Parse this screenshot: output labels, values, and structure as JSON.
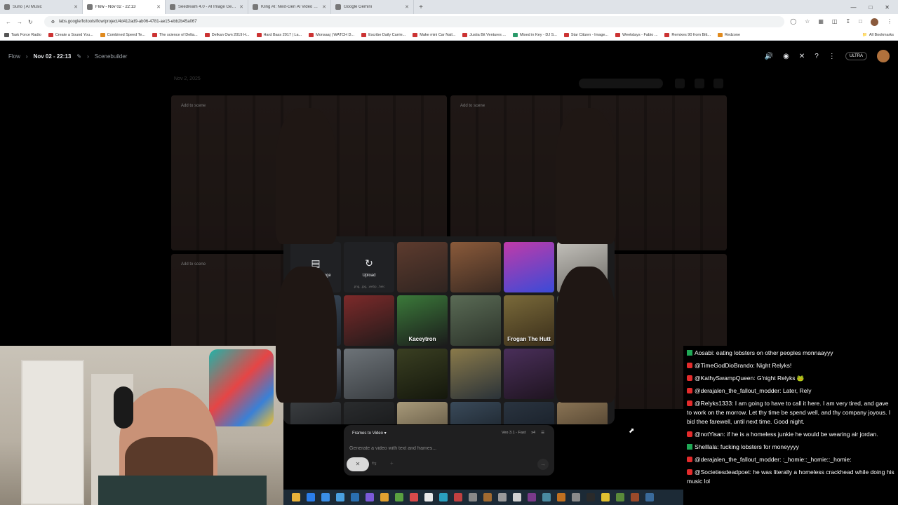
{
  "browser": {
    "tabs": [
      {
        "label": "Suno | AI Music",
        "active": false
      },
      {
        "label": "Flow - Nov 02 - 22:13",
        "active": true
      },
      {
        "label": "Seedream 4.0 - AI Image Gene...",
        "active": false
      },
      {
        "label": "Kling AI: Next-Gen AI Video &...",
        "active": false
      },
      {
        "label": "Google Gemini",
        "active": false
      }
    ],
    "url": "labs.google/fx/tools/flow/project/4d412ad9-ab06-4781-ae15-ebb2b45a067",
    "bookmarks": [
      "Task Force Radio",
      "Create a Sound You...",
      "Combined Speed Te...",
      "The science of Delta...",
      "Delkan Own 2019 H...",
      "Hard Bass 2017 | La...",
      "Monsaaj | WATCH D...",
      "Escribe Daily Carrie...",
      "Make mini Car Nail...",
      "Justia Bit Ventures ...",
      "Mixed in Key - DJ S...",
      "Star Citizen - Image...",
      "Weekdays - Fabio ...",
      "Remixes 90 from Bitt...",
      "Redzone"
    ],
    "bookmarks_right": "All Bookmarks"
  },
  "app": {
    "brand": "Flow",
    "project": "Nov 02 - 22:13",
    "view": "Scenebuilder",
    "badge": "ULTRA",
    "date_label": "Nov 2, 2025"
  },
  "scenes": [
    {
      "tag": "Add to scene"
    },
    {
      "tag": "Add to scene"
    },
    {
      "tag": "Add to scene"
    }
  ],
  "picker": {
    "generate_label": "Generate Image",
    "upload_label": "Upload",
    "upload_sub": ".png, .jpg, .webp, .heic",
    "tiles": [
      {
        "caption": "",
        "colors": [
          "#5d3b2e",
          "#2f2420"
        ]
      },
      {
        "caption": "",
        "colors": [
          "#8a5a3a",
          "#3a2a22"
        ]
      },
      {
        "caption": "",
        "colors": [
          "#c13aa8",
          "#3a4bd8"
        ]
      },
      {
        "caption": "",
        "colors": [
          "#c2c0ba",
          "#6e6b66"
        ]
      },
      {
        "caption": "",
        "colors": [
          "#3c4a5a",
          "#1d242c"
        ]
      },
      {
        "caption": "",
        "colors": [
          "#7d2a2a",
          "#211a1a"
        ]
      },
      {
        "caption": "Kaceytron",
        "colors": [
          "#3b7a3a",
          "#1b1b1b"
        ]
      },
      {
        "caption": "",
        "colors": [
          "#5a6b55",
          "#2c332a"
        ]
      },
      {
        "caption": "Frogan The Hutt",
        "colors": [
          "#7a6a3a",
          "#3a2e1a"
        ]
      },
      {
        "caption": "",
        "colors": [
          "#4a5a4a",
          "#1c2420"
        ]
      },
      {
        "caption": "",
        "colors": [
          "#6a7482",
          "#1c2026"
        ]
      },
      {
        "caption": "",
        "colors": [
          "#6d7378",
          "#3a3e42"
        ]
      },
      {
        "caption": "",
        "colors": [
          "#3a3f22",
          "#14170c"
        ]
      },
      {
        "caption": "",
        "colors": [
          "#8a7a4a",
          "#2a3238"
        ]
      },
      {
        "caption": "",
        "colors": [
          "#4a2f5a",
          "#1f1420"
        ]
      },
      {
        "caption": "",
        "colors": [
          "#d4d8dc",
          "#9aa0a6"
        ]
      },
      {
        "caption": "",
        "colors": [
          "#3a3d40",
          "#15171a"
        ]
      },
      {
        "caption": "",
        "colors": [
          "#2a2c2e",
          "#111213"
        ]
      },
      {
        "caption": "",
        "colors": [
          "#a89a7a",
          "#4a4030"
        ]
      },
      {
        "caption": "",
        "colors": [
          "#3a4a5a",
          "#12181e"
        ]
      },
      {
        "caption": "",
        "colors": [
          "#2a3440",
          "#121820"
        ]
      },
      {
        "caption": "",
        "colors": [
          "#8a7455",
          "#3a2e20"
        ]
      }
    ]
  },
  "prompt": {
    "mode": "Frames to Video",
    "model": "Veo 3.1 - Fast",
    "count": "x4",
    "placeholder": "Generate a video with text and frames..."
  },
  "chat": [
    {
      "badge": "green",
      "user": "Aosabi",
      "text": "eating lobsters on other peoples monnaayyy"
    },
    {
      "badge": "red",
      "user": "@TimeGodDioBrando",
      "text": "Night Relyks!"
    },
    {
      "badge": "red",
      "user": "@KathySwampQueen",
      "text": "G'night Relyks 🐸"
    },
    {
      "badge": "red",
      "user": "@derajalen_the_fallout_modder",
      "text": "Later, Rely"
    },
    {
      "badge": "red",
      "user": "@Relyks1333",
      "text": "I am going to have to call it here. I am very tired, and gave to work on the morrow. Let thy time be spend well, and thy company joyous. I bid thee farewell, until next time. Good night."
    },
    {
      "badge": "red",
      "user": "@notYisan",
      "text": "if he is a homeless junkie he would be wearing air jordan."
    },
    {
      "badge": "green",
      "user": "Shelllala",
      "text": "fucking lobsters for moneyyyy"
    },
    {
      "badge": "red",
      "user": "@derajalen_the_fallout_modder",
      "text": ":_homie::_homie::_homie:"
    },
    {
      "badge": "red",
      "user": "@Societiesdeadpoet",
      "text": "he was literally a homeless crackhead while doing his music lol"
    }
  ]
}
